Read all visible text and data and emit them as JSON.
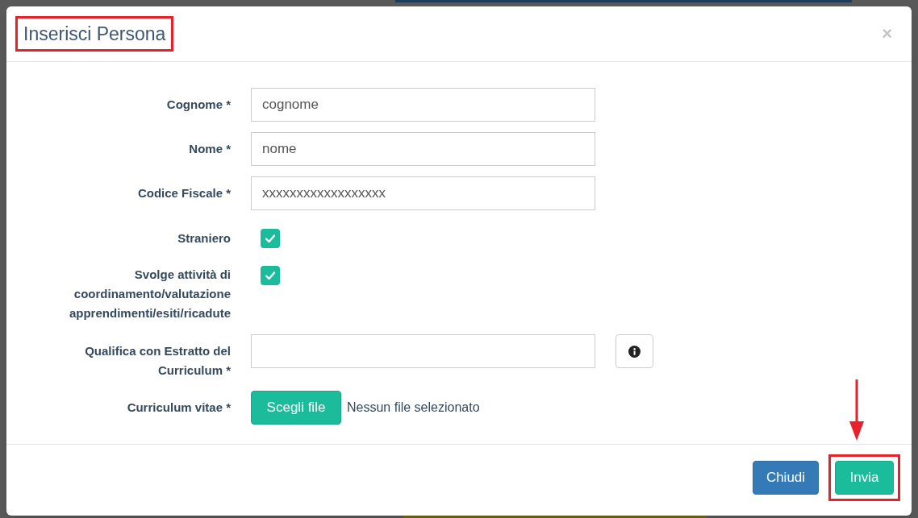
{
  "dialog": {
    "title": "Inserisci Persona",
    "title_highlighted": true,
    "close": "×"
  },
  "fields": [
    {
      "kind": "text",
      "label": "Cognome *",
      "value": "cognome"
    },
    {
      "kind": "text",
      "label": "Nome *",
      "value": "nome"
    },
    {
      "kind": "text",
      "label": "Codice Fiscale *",
      "value": "xxxxxxxxxxxxxxxxxx"
    },
    {
      "kind": "checkbox",
      "label": "Straniero",
      "checked": true
    },
    {
      "kind": "checkbox",
      "label": "Svolge attività di coordinamento/valutazione apprendimenti/esiti/ricadute",
      "checked": true
    },
    {
      "kind": "text_info",
      "label": "Qualifica con Estratto del Curriculum *"
    },
    {
      "kind": "file",
      "label": "Curriculum vitae *",
      "button": "Scegli file",
      "status": "Nessun file selezionato"
    }
  ],
  "buttons": [
    {
      "label": "Chiudi",
      "kind": "primary",
      "highlighted": false
    },
    {
      "label": "Invia",
      "kind": "success",
      "highlighted": true
    }
  ]
}
